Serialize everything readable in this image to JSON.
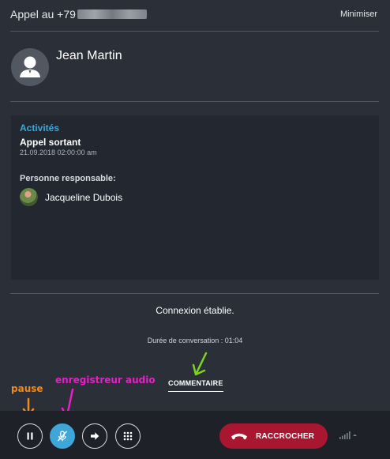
{
  "header": {
    "title": "Appel au +79",
    "minimize_label": "Minimiser"
  },
  "contact": {
    "name": "Jean Martin",
    "avatar_icon": "user-silhouette-icon"
  },
  "details": {
    "section_title": "Activités",
    "activity": "Appel sortant",
    "date": "21.09.2018 02:00:00 am",
    "responsible_label": "Personne responsable:",
    "responsible_name": "Jacqueline Dubois"
  },
  "call": {
    "status": "Connexion établie.",
    "duration": "Durée de conversation : 01:04",
    "comment_label": "COMMENTAIRE"
  },
  "annotations": {
    "pause": "pause",
    "recorder": "enregistreur audio"
  },
  "controls": {
    "hangup_label": "RACCROCHER",
    "icons": [
      "pause-icon",
      "mic-off-icon",
      "transfer-arrow-icon",
      "dialpad-icon",
      "phone-hangup-icon",
      "signal-icon"
    ]
  },
  "colors": {
    "accent": "#3ea6d9",
    "hangup": "#a8172f",
    "annotation_pause": "#f08a1a",
    "annotation_recorder": "#e91ec8",
    "annotation_comment": "#7ed321"
  }
}
